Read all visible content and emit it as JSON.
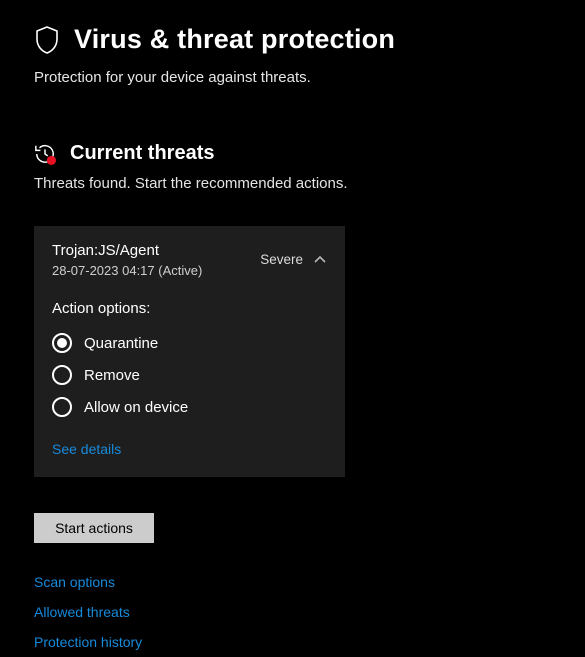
{
  "page": {
    "title": "Virus & threat protection",
    "subtitle": "Protection for your device against threats."
  },
  "section": {
    "title": "Current threats",
    "subtitle": "Threats found. Start the recommended actions."
  },
  "threat": {
    "name": "Trojan:JS/Agent",
    "meta": "28-07-2023 04:17 (Active)",
    "severity": "Severe",
    "actions_label": "Action options:",
    "options": {
      "quarantine": "Quarantine",
      "remove": "Remove",
      "allow": "Allow on device"
    },
    "see_details": "See details"
  },
  "buttons": {
    "start_actions": "Start actions"
  },
  "links": {
    "scan_options": "Scan options",
    "allowed_threats": "Allowed threats",
    "protection_history": "Protection history"
  },
  "colors": {
    "accent": "#178adb",
    "danger": "#e81123"
  }
}
